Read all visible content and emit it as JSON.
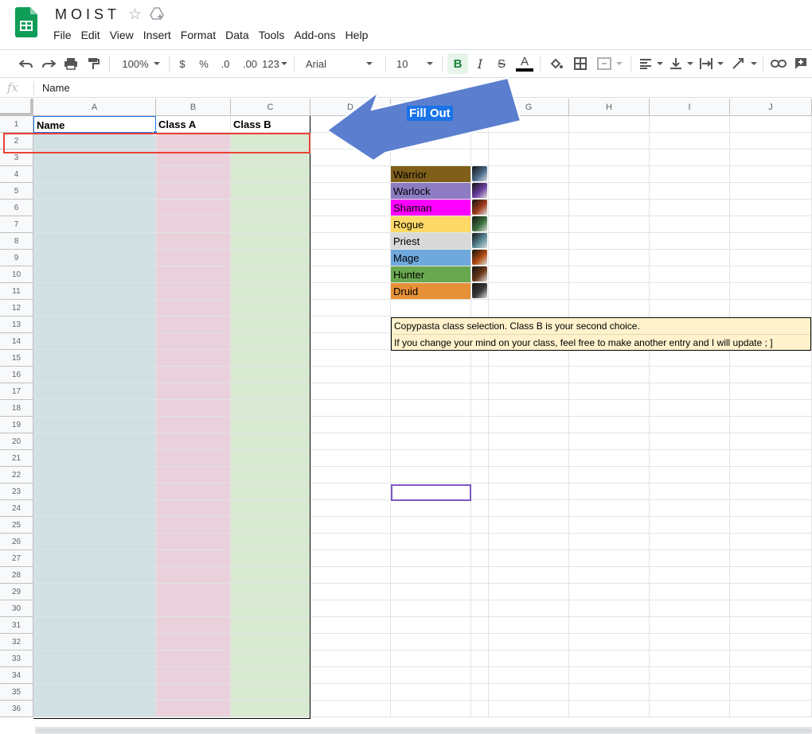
{
  "doc": {
    "title": "MOIST"
  },
  "menu": [
    "File",
    "Edit",
    "View",
    "Insert",
    "Format",
    "Data",
    "Tools",
    "Add-ons",
    "Help"
  ],
  "toolbar": {
    "zoom": "100%",
    "currency": "$",
    "percent": "%",
    "dec_less": ".0",
    "dec_more": ".00",
    "more_formats": "123",
    "font": "Arial",
    "font_size": "10",
    "bold": "B",
    "italic": "I",
    "strike": "S",
    "text_color": "A"
  },
  "formula_bar": {
    "fx": "fx",
    "value": "Name"
  },
  "columns": [
    "A",
    "B",
    "C",
    "D",
    "E",
    "F",
    "G",
    "H",
    "I",
    "J"
  ],
  "rows": [
    "1",
    "2",
    "3",
    "4",
    "5",
    "6",
    "7",
    "8",
    "9",
    "10",
    "11",
    "12",
    "13",
    "14",
    "15",
    "16",
    "17",
    "18",
    "19",
    "20",
    "21",
    "22",
    "23",
    "24",
    "25",
    "26",
    "27",
    "28",
    "29",
    "30",
    "31",
    "32",
    "33",
    "34",
    "35",
    "36"
  ],
  "table": {
    "headers": [
      "Name",
      "Class A",
      "Class B"
    ]
  },
  "classes": [
    {
      "name": "Warrior",
      "color": "#7f5f1a",
      "icon": "sword-icon"
    },
    {
      "name": "Warlock",
      "color": "#8e7cc3",
      "icon": "fel-icon"
    },
    {
      "name": "Shaman",
      "color": "#ff00ff",
      "icon": "totem-icon"
    },
    {
      "name": "Rogue",
      "color": "#ffd966",
      "icon": "dagger-icon"
    },
    {
      "name": "Priest",
      "color": "#d9d9d9",
      "icon": "holy-icon"
    },
    {
      "name": "Mage",
      "color": "#6fa8dc",
      "icon": "fire-icon"
    },
    {
      "name": "Hunter",
      "color": "#6aa84f",
      "icon": "bow-icon"
    },
    {
      "name": "Druid",
      "color": "#e69138",
      "icon": "paw-icon"
    }
  ],
  "note": [
    "Copypasta class selection. Class B is your second choice.",
    "If you change your mind on your class, feel free to make another entry and I will update ; ]"
  ],
  "annotation": {
    "label": "Fill Out"
  },
  "colors": {
    "col_a": "#d0e0e3",
    "col_b": "#ead1dc",
    "col_c": "#d9ead3",
    "note_bg": "#fff2cc",
    "highlight": "#ea4335",
    "selection": "#7e57c2",
    "arrow": "#5b7fce"
  }
}
